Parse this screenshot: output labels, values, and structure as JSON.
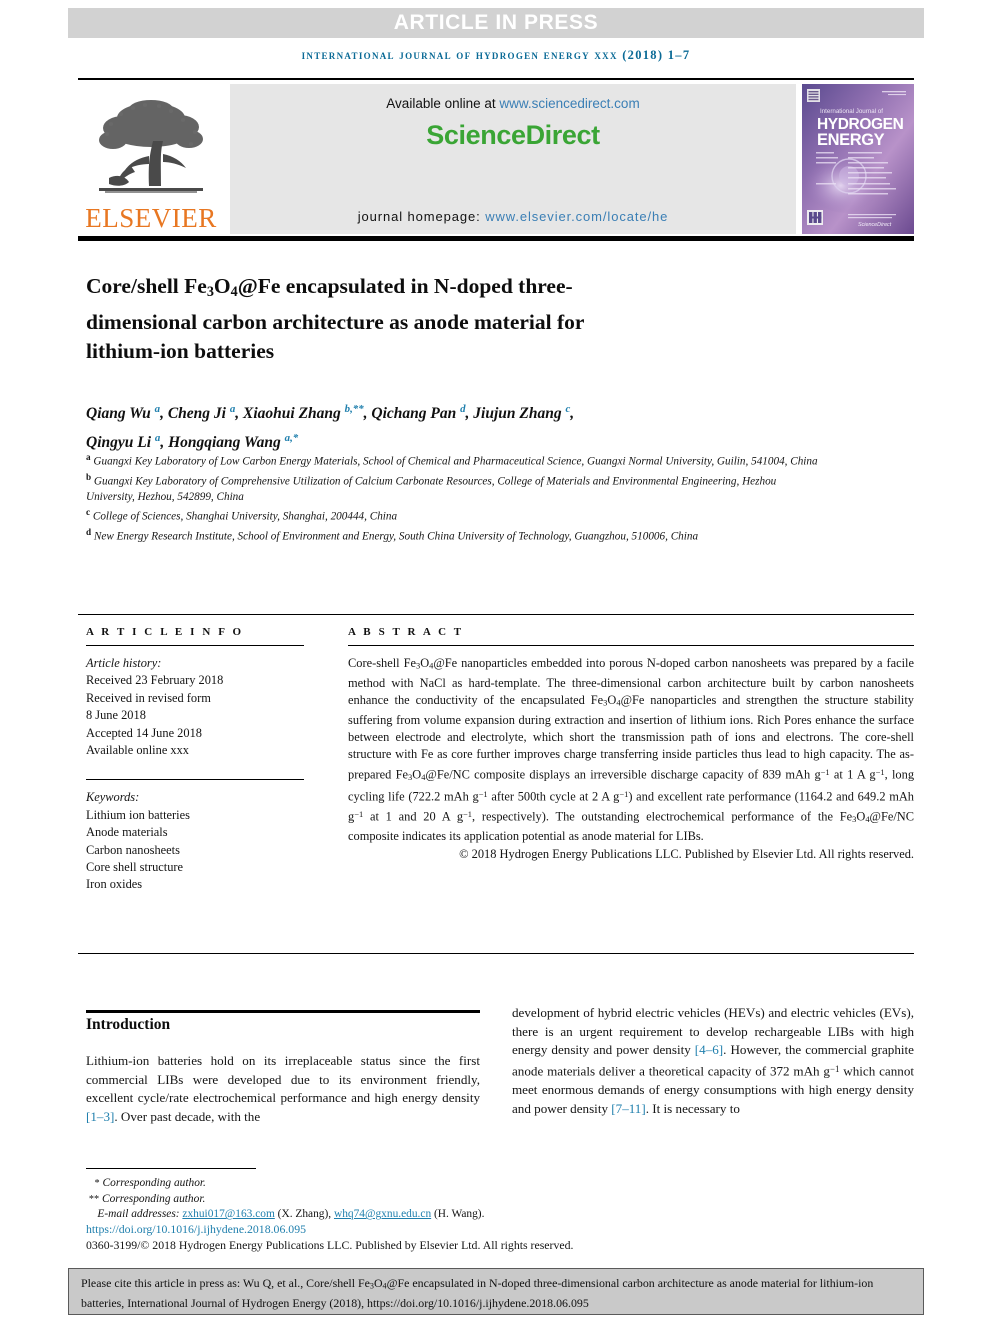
{
  "banner": {
    "article_in_press": "ARTICLE IN PRESS"
  },
  "journal_line": "international journal of hydrogen energy xxx (2018) 1–7",
  "masthead": {
    "publisher_name": "ELSEVIER",
    "available_prefix": "Available online at ",
    "available_url": "www.sciencedirect.com",
    "sciencedirect_logo": "ScienceDirect",
    "homepage_prefix": "journal homepage: ",
    "homepage_url": "www.elsevier.com/locate/he",
    "cover_title_small": "International Journal of",
    "cover_title_1": "HYDROGEN",
    "cover_title_2": "ENERGY",
    "cover_footer": "ScienceDirect"
  },
  "title": {
    "line1_a": "Core/shell Fe",
    "line1_sub1": "3",
    "line1_b": "O",
    "line1_sub2": "4",
    "line1_c": "@Fe encapsulated in N-doped",
    "line2": "three-dimensional carbon architecture as anode",
    "line3": "material for lithium-ion batteries"
  },
  "authors": [
    {
      "name": "Qiang Wu",
      "marks": "a"
    },
    {
      "name": "Cheng Ji",
      "marks": "a"
    },
    {
      "name": "Xiaohui Zhang",
      "marks": "b,**"
    },
    {
      "name": "Qichang Pan",
      "marks": "d"
    },
    {
      "name": "Jiujun Zhang",
      "marks": "c"
    },
    {
      "name": "Qingyu Li",
      "marks": "a"
    },
    {
      "name": "Hongqiang Wang",
      "marks": "a,*"
    }
  ],
  "affiliations": [
    {
      "mark": "a",
      "text": "Guangxi Key Laboratory of Low Carbon Energy Materials, School of Chemical and Pharmaceutical Science, Guangxi Normal University, Guilin, 541004, China"
    },
    {
      "mark": "b",
      "text": "Guangxi Key Laboratory of Comprehensive Utilization of Calcium Carbonate Resources, College of Materials and Environmental Engineering, Hezhou University, Hezhou, 542899, China"
    },
    {
      "mark": "c",
      "text": "College of Sciences, Shanghai University, Shanghai, 200444, China"
    },
    {
      "mark": "d",
      "text": "New Energy Research Institute, School of Environment and Energy, South China University of Technology, Guangzhou, 510006, China"
    }
  ],
  "article_info": {
    "heading": "A R T I C L E   I N F O",
    "history_label": "Article history:",
    "history": [
      "Received 23 February 2018",
      "Received in revised form",
      "8 June 2018",
      "Accepted 14 June 2018",
      "Available online xxx"
    ],
    "keywords_label": "Keywords:",
    "keywords": [
      "Lithium ion batteries",
      "Anode materials",
      "Carbon nanosheets",
      "Core shell structure",
      "Iron oxides"
    ]
  },
  "abstract": {
    "heading": "A B S T R A C T",
    "part1": "Core-shell Fe",
    "sub1": "3",
    "part2": "O",
    "sub2": "4",
    "part3": "@Fe nanoparticles embedded into porous N-doped carbon nanosheets was prepared by a facile method with NaCl as hard-template. The three-dimensional carbon architecture built by carbon nanosheets enhance the conductivity of the encapsulated Fe",
    "part4": "@Fe nanoparticles and strengthen the structure stability suffering from volume expansion during extraction and insertion of lithium ions. Rich Pores enhance the surface between electrode and electrolyte, which short the transmission path of ions and electrons. The core-shell structure with Fe as core further improves charge transferring inside particles thus lead to high capacity. The as-prepared Fe",
    "part5": "@Fe/NC composite displays an irreversible discharge capacity of 839 mAh g",
    "sup1": "−1",
    "part6": " at 1 A g",
    "sup2": "−1",
    "part7": ", long cycling life (722.2 mAh g",
    "sup3": "−1",
    "part8": " after 500th cycle at 2 A g",
    "sup4": "−1",
    "part9": ") and excellent rate performance (1164.2 and 649.2 mAh g",
    "sup5": "−1",
    "part10": " at 1 and 20 A g",
    "sup6": "−1",
    "part11": ", respectively). The outstanding electrochemical performance of the Fe",
    "part12": "@Fe/NC composite indicates its application potential as anode material for LIBs.",
    "copyright": "© 2018 Hydrogen Energy Publications LLC. Published by Elsevier Ltd. All rights reserved."
  },
  "introduction": {
    "heading": "Introduction",
    "left_para": "Lithium-ion batteries hold on its irreplaceable status since the first commercial LIBs were developed due to its environment friendly, excellent cycle/rate electrochemical performance and high energy density ",
    "left_ref": "[1–3]",
    "left_para_tail": ". Over past decade, with the",
    "right_pre": "development of hybrid electric vehicles (HEVs) and electric vehicles (EVs), there is an urgent requirement to develop rechargeable LIBs with high energy density and power density ",
    "right_ref1": "[4–6]",
    "right_mid": ". However, the commercial graphite anode materials deliver a theoretical capacity of 372 mAh g",
    "right_sup": "−1",
    "right_mid2": " which cannot meet enormous demands of energy consumptions with high energy density and power density ",
    "right_ref2": "[7–11]",
    "right_tail": ". It is necessary to"
  },
  "footnotes": {
    "corresponding_1_mark": "*",
    "corresponding_1": "Corresponding author.",
    "corresponding_2_mark": "**",
    "corresponding_2": "Corresponding author.",
    "email_label": "E-mail addresses: ",
    "email_1": "zxhui017@163.com",
    "email_1_name": " (X. Zhang), ",
    "email_2": "whq74@gxnu.edu.cn",
    "email_2_name": " (H. Wang).",
    "doi": "https://doi.org/10.1016/j.ijhydene.2018.06.095",
    "issn": "0360-3199/© 2018 Hydrogen Energy Publications LLC. Published by Elsevier Ltd. All rights reserved."
  },
  "cite_banner": {
    "pre": "Please cite this article in press as: Wu Q, et al., Core/shell Fe",
    "sub1": "3",
    "mid1": "O",
    "sub2": "4",
    "post": "@Fe encapsulated in N-doped three-dimensional carbon architecture as anode material for lithium-ion batteries, International Journal of Hydrogen Energy (2018), https://doi.org/10.1016/j.ijhydene.2018.06.095"
  },
  "colors": {
    "accent_blue": "#1f7fad",
    "elsevier_orange": "#e87722",
    "sciencedirect_green": "#3aa535",
    "banner_gray": "#d2d2d2",
    "cite_gray": "#c9c9c9"
  }
}
